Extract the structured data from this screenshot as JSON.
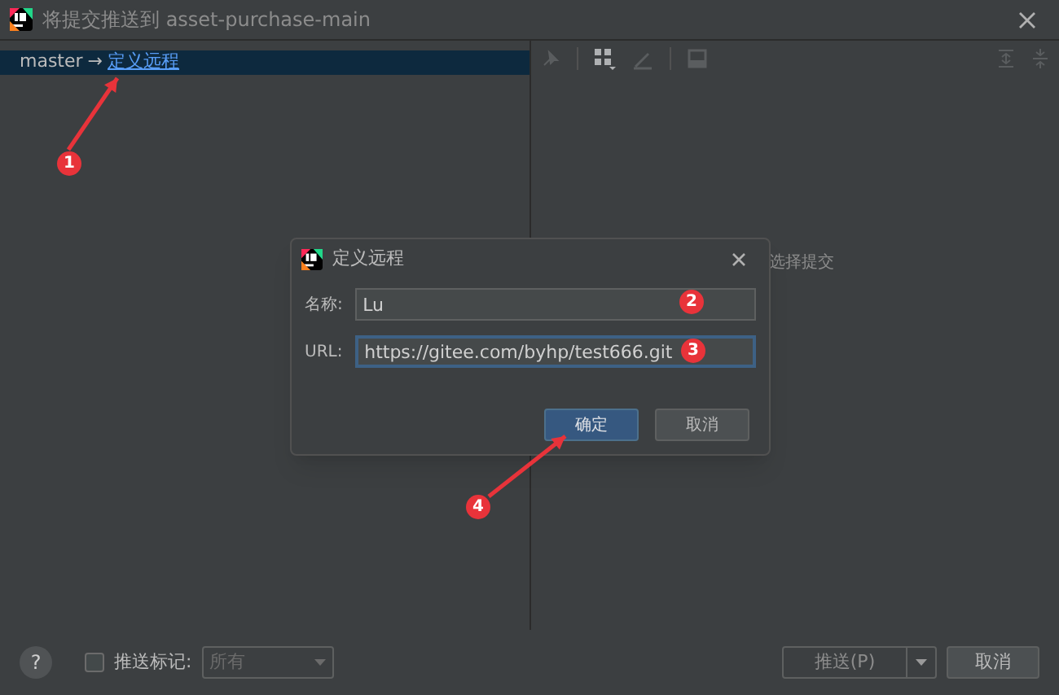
{
  "window": {
    "title": "将提交推送到 asset-purchase-main"
  },
  "branch_row": {
    "branch": "master",
    "arrow": "→",
    "link": "定义远程",
    "selected": true
  },
  "details_hint": "选择提交",
  "bottom_bar": {
    "help": "?",
    "push_tags": {
      "label": "推送标记:",
      "checked": false
    },
    "tags_dropdown": {
      "value": "所有",
      "disabled": true
    },
    "push_button": "推送(P)",
    "cancel_button": "取消"
  },
  "dialog": {
    "title": "定义远程",
    "fields": [
      {
        "label": "名称:",
        "value": "Lu",
        "focused": false
      },
      {
        "label": "URL:",
        "value": "https://gitee.com/byhp/test666.git",
        "focused": true
      }
    ],
    "buttons": [
      {
        "label": "确定",
        "default": true
      },
      {
        "label": "取消",
        "default": false
      }
    ]
  },
  "annotations": [
    {
      "label": "1"
    },
    {
      "label": "2"
    },
    {
      "label": "3"
    },
    {
      "label": "4"
    }
  ]
}
